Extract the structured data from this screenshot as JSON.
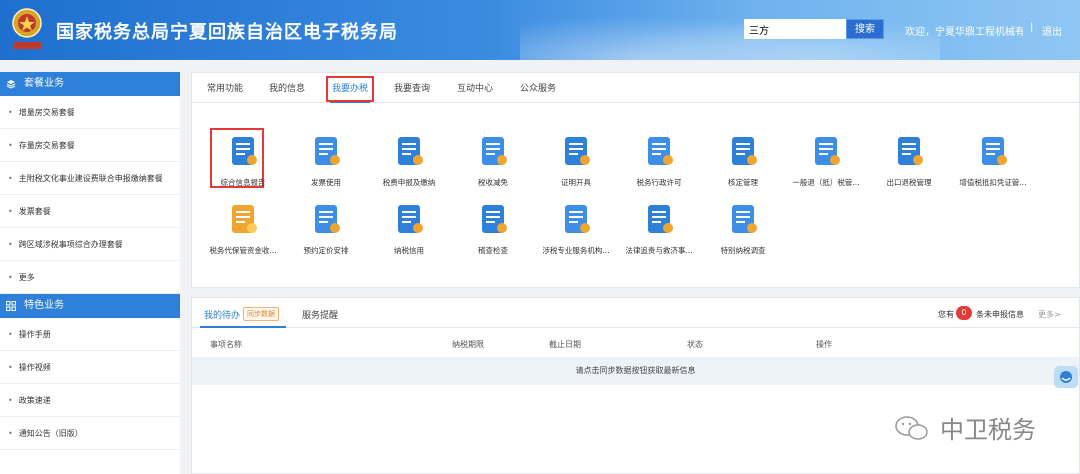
{
  "header": {
    "title": "国家税务总局宁夏回族自治区电子税务局",
    "search_value": "三方",
    "search_button": "搜索",
    "welcome": "欢迎，宁夏华鼎工程机械有...",
    "separator": "|",
    "logout": "退出"
  },
  "sidebar": {
    "section1_title": "套餐业务",
    "section1_items": [
      "增量房交易套餐",
      "存量房交易套餐",
      "主附税文化事业建设费联合申报缴纳套餐",
      "发票套餐",
      "跨区域涉税事项综合办理套餐",
      "更多"
    ],
    "section2_title": "特色业务",
    "section2_items": [
      "操作手册",
      "操作视频",
      "政策速递",
      "通知公告（旧版）"
    ]
  },
  "tabs": [
    "常用功能",
    "我的信息",
    "我要办税",
    "我要查询",
    "互动中心",
    "公众服务"
  ],
  "functions": [
    {
      "label": "综合信息报告",
      "icon": "report-icon"
    },
    {
      "label": "发票使用",
      "icon": "invoice-icon"
    },
    {
      "label": "税费申报及缴纳",
      "icon": "declare-icon"
    },
    {
      "label": "税收减免",
      "icon": "reduction-icon"
    },
    {
      "label": "证明开具",
      "icon": "certificate-icon"
    },
    {
      "label": "税务行政许可",
      "icon": "permit-icon"
    },
    {
      "label": "核定管理",
      "icon": "verify-icon"
    },
    {
      "label": "一般退（抵）税管...",
      "icon": "refund-icon"
    },
    {
      "label": "出口退税管理",
      "icon": "export-refund-icon"
    },
    {
      "label": "增值税抵扣凭证管...",
      "icon": "vat-icon"
    },
    {
      "label": "税务代保管资金收...",
      "icon": "custody-icon"
    },
    {
      "label": "预约定价安排",
      "icon": "pricing-icon"
    },
    {
      "label": "纳税信用",
      "icon": "credit-icon"
    },
    {
      "label": "稽查检查",
      "icon": "inspection-icon"
    },
    {
      "label": "涉税专业服务机构...",
      "icon": "agency-icon"
    },
    {
      "label": "法律追责与救济事...",
      "icon": "legal-icon"
    },
    {
      "label": "特别纳税调查",
      "icon": "special-icon"
    }
  ],
  "todo": {
    "tab1": "我的待办",
    "sync_badge": "同步数据",
    "tab2": "服务提醒",
    "notice_prefix": "您有",
    "notice_count": "0",
    "notice_suffix": "条未申报信息",
    "more": "更多>",
    "columns": [
      "事项名称",
      "纳税期限",
      "截止日期",
      "状态",
      "操作"
    ],
    "empty_message": "请点击同步数据按钮获取最新信息"
  },
  "watermark": "中卫税务",
  "colors": {
    "primary": "#2f80d9",
    "highlight": "#e53935"
  }
}
